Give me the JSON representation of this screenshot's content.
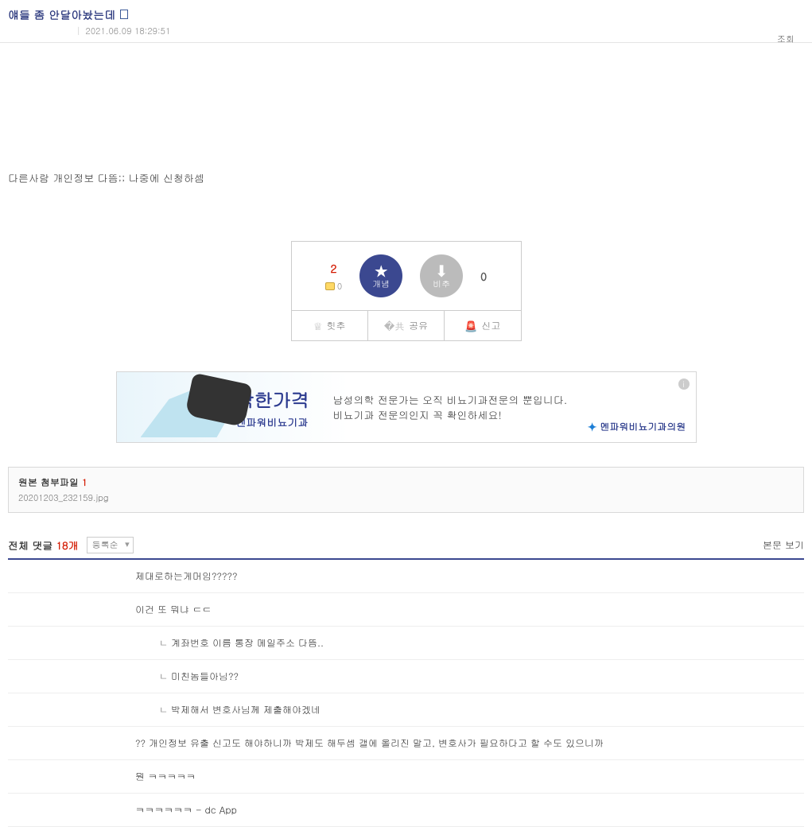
{
  "post": {
    "title": "얘들 좀 안달아놨는데",
    "timestamp": "2021.06.09 18:29:51",
    "views_label": "조회",
    "body": "다른사람 개인정보 다뜸;; 나중에 신청하셈"
  },
  "vote": {
    "up_count": "2",
    "coin_count": "0",
    "up_label": "개념",
    "down_label": "비추",
    "down_count": "0",
    "hit_label": "힛추",
    "share_label": "공유",
    "report_label": "신고"
  },
  "ad": {
    "headline": "착한가격",
    "subline": "멘파워비뇨기과",
    "desc1": "남성의학 전문가는 오직 비뇨기과전문의 뿐입니다.",
    "desc2": "비뇨기과 전문의인지 꼭 확인하세요!",
    "logo": "멘파워비뇨기과의원"
  },
  "attach": {
    "label": "원본 첨부파일",
    "count": "1",
    "files": [
      "20201203_232159.jpg"
    ]
  },
  "comments_head": {
    "label": "전체 댓글",
    "count": "18개",
    "sort": "등록순",
    "body_view": "본문 보기"
  },
  "comments": [
    {
      "text": "제대로하는게머임?????",
      "reply": false
    },
    {
      "text": "이건 또 뭐냐 ㄷㄷ",
      "reply": false
    },
    {
      "text": "계좌번호 이름 통장 메일주소 다뜸..",
      "reply": true
    },
    {
      "text": "미친놈들아님??",
      "reply": true
    },
    {
      "text": "박제해서 변호사님께 제출해야겠네",
      "reply": true
    },
    {
      "text": "?? 개인정보 유출 신고도 해야하니까 박제도 해두셈 갤에 올리진 말고, 변호사가 필요하다고 할 수도 있으니까",
      "reply": false
    },
    {
      "text": "뭔 ㅋㅋㅋㅋㅋ",
      "reply": false
    },
    {
      "text": "ㅋㅋㅋㅋㅋㅋ - dc App",
      "reply": false
    }
  ]
}
